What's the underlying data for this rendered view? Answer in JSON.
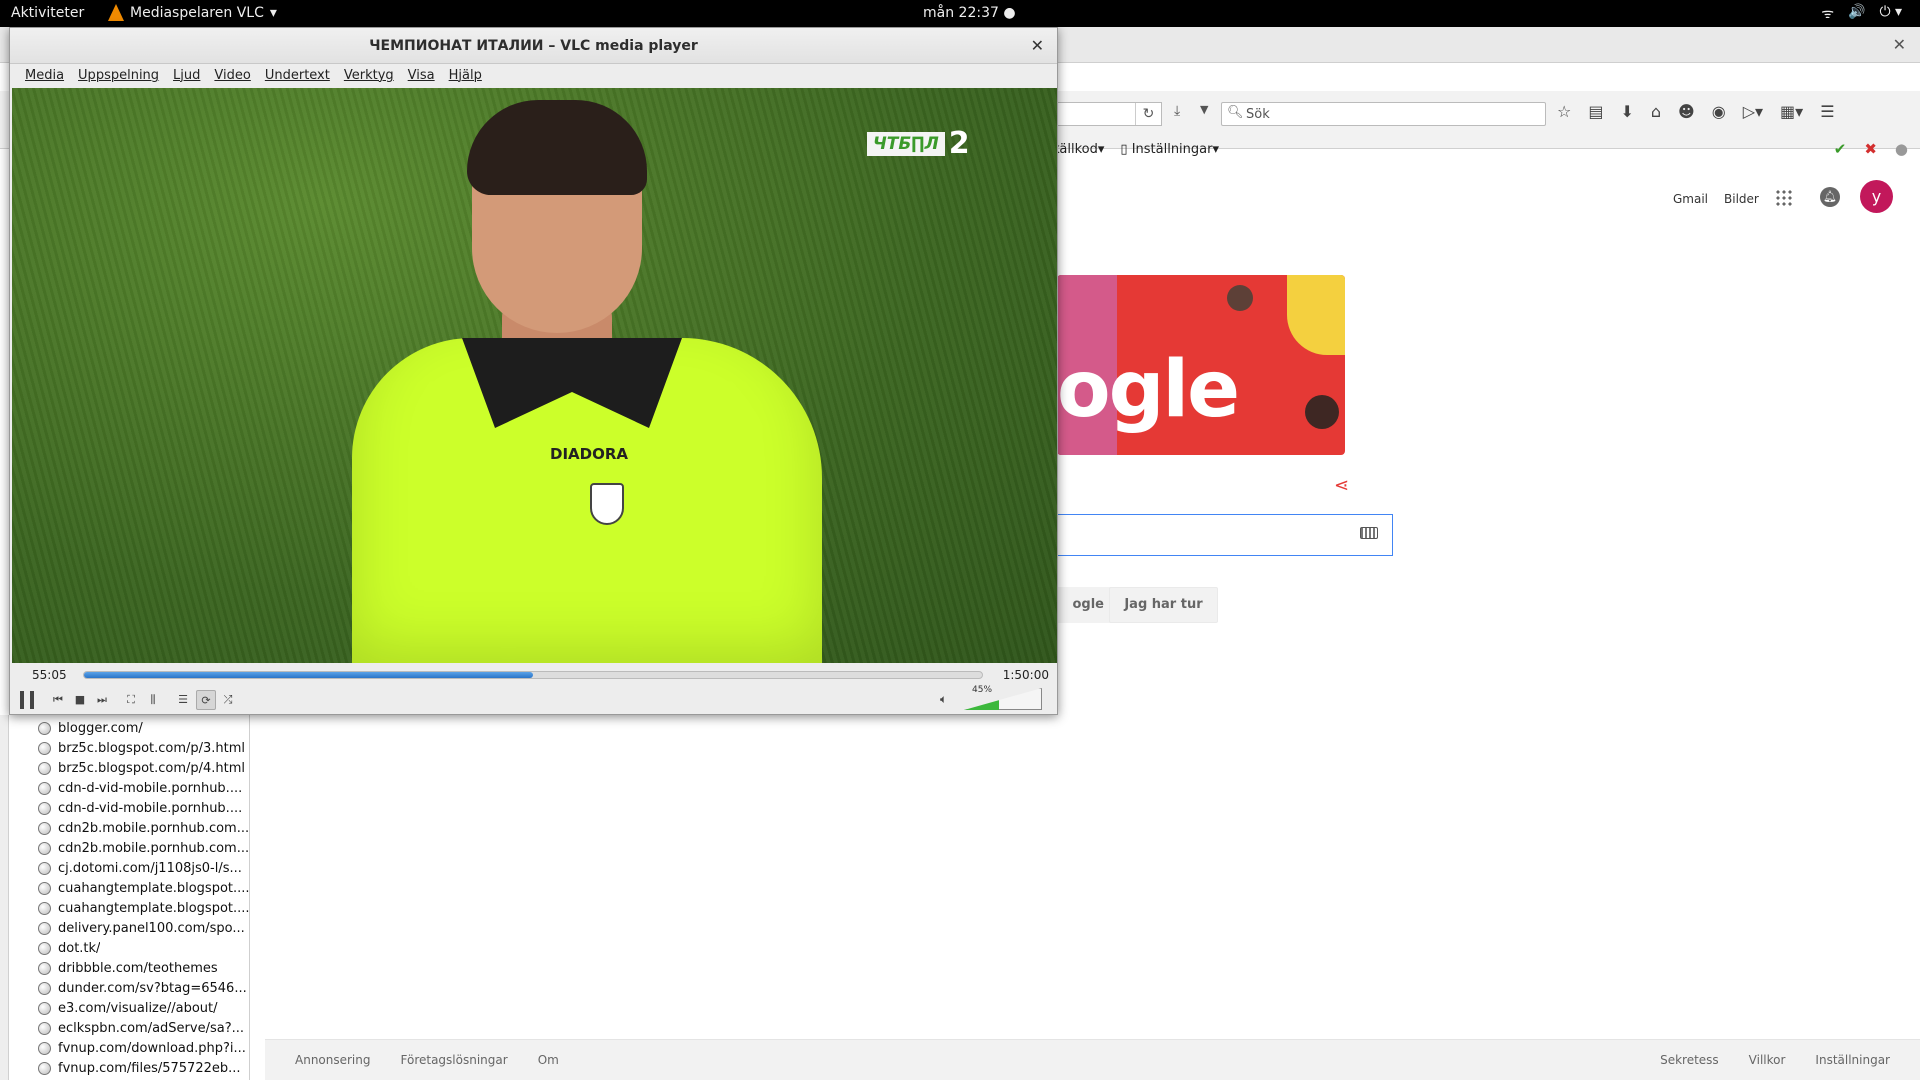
{
  "topbar": {
    "activities": "Aktiviteter",
    "app_name": "Mediaspelaren VLC",
    "clock": "mån 22:37",
    "tray_icons": [
      "wifi-icon",
      "volume-icon",
      "power-icon"
    ]
  },
  "firefox": {
    "search_placeholder": "Sök",
    "bookmarks": [
      "a källkod",
      "Inställningar"
    ],
    "header_links": {
      "gmail": "Gmail",
      "images": "Bilder",
      "avatar": "y"
    },
    "doodle_text": "ogle",
    "buttons": {
      "search": "ogle",
      "lucky": "Jag har tur"
    },
    "history": [
      "blogger.com/",
      "brz5c.blogspot.com/p/3.html",
      "brz5c.blogspot.com/p/4.html",
      "cdn-d-vid-mobile.pornhub....",
      "cdn-d-vid-mobile.pornhub....",
      "cdn2b.mobile.pornhub.com...",
      "cdn2b.mobile.pornhub.com...",
      "cj.dotomi.com/j1108js0-l/s...",
      "cuahangtemplate.blogspot....",
      "cuahangtemplate.blogspot....",
      "delivery.panel100.com/spo...",
      "dot.tk/",
      "dribbble.com/teothemes",
      "dunder.com/sv?btag=6546...",
      "e3.com/visualize//about/",
      "eclkspbn.com/adServe/sa?...",
      "fvnup.com/download.php?i...",
      "fvnup.com/files/575722eb..."
    ],
    "footer_left": [
      "Annonsering",
      "Företagslösningar",
      "Om"
    ],
    "footer_right": [
      "Sekretess",
      "Villkor",
      "Inställningar"
    ]
  },
  "vlc": {
    "title": "ЧЕМПИОНАТ ИТАЛИИ – VLC media player",
    "menu": [
      "Media",
      "Uppspelning",
      "Ljud",
      "Video",
      "Undertext",
      "Verktyg",
      "Visa",
      "Hjälp"
    ],
    "channel_logo": "ЧТБ∏Л",
    "channel_number": "2",
    "shirt_brand": "DIADORA",
    "time_current": "55:05",
    "time_total": "1:50:00",
    "progress_fraction": 0.5,
    "volume_label": "45%",
    "volume_fraction": 0.45
  }
}
